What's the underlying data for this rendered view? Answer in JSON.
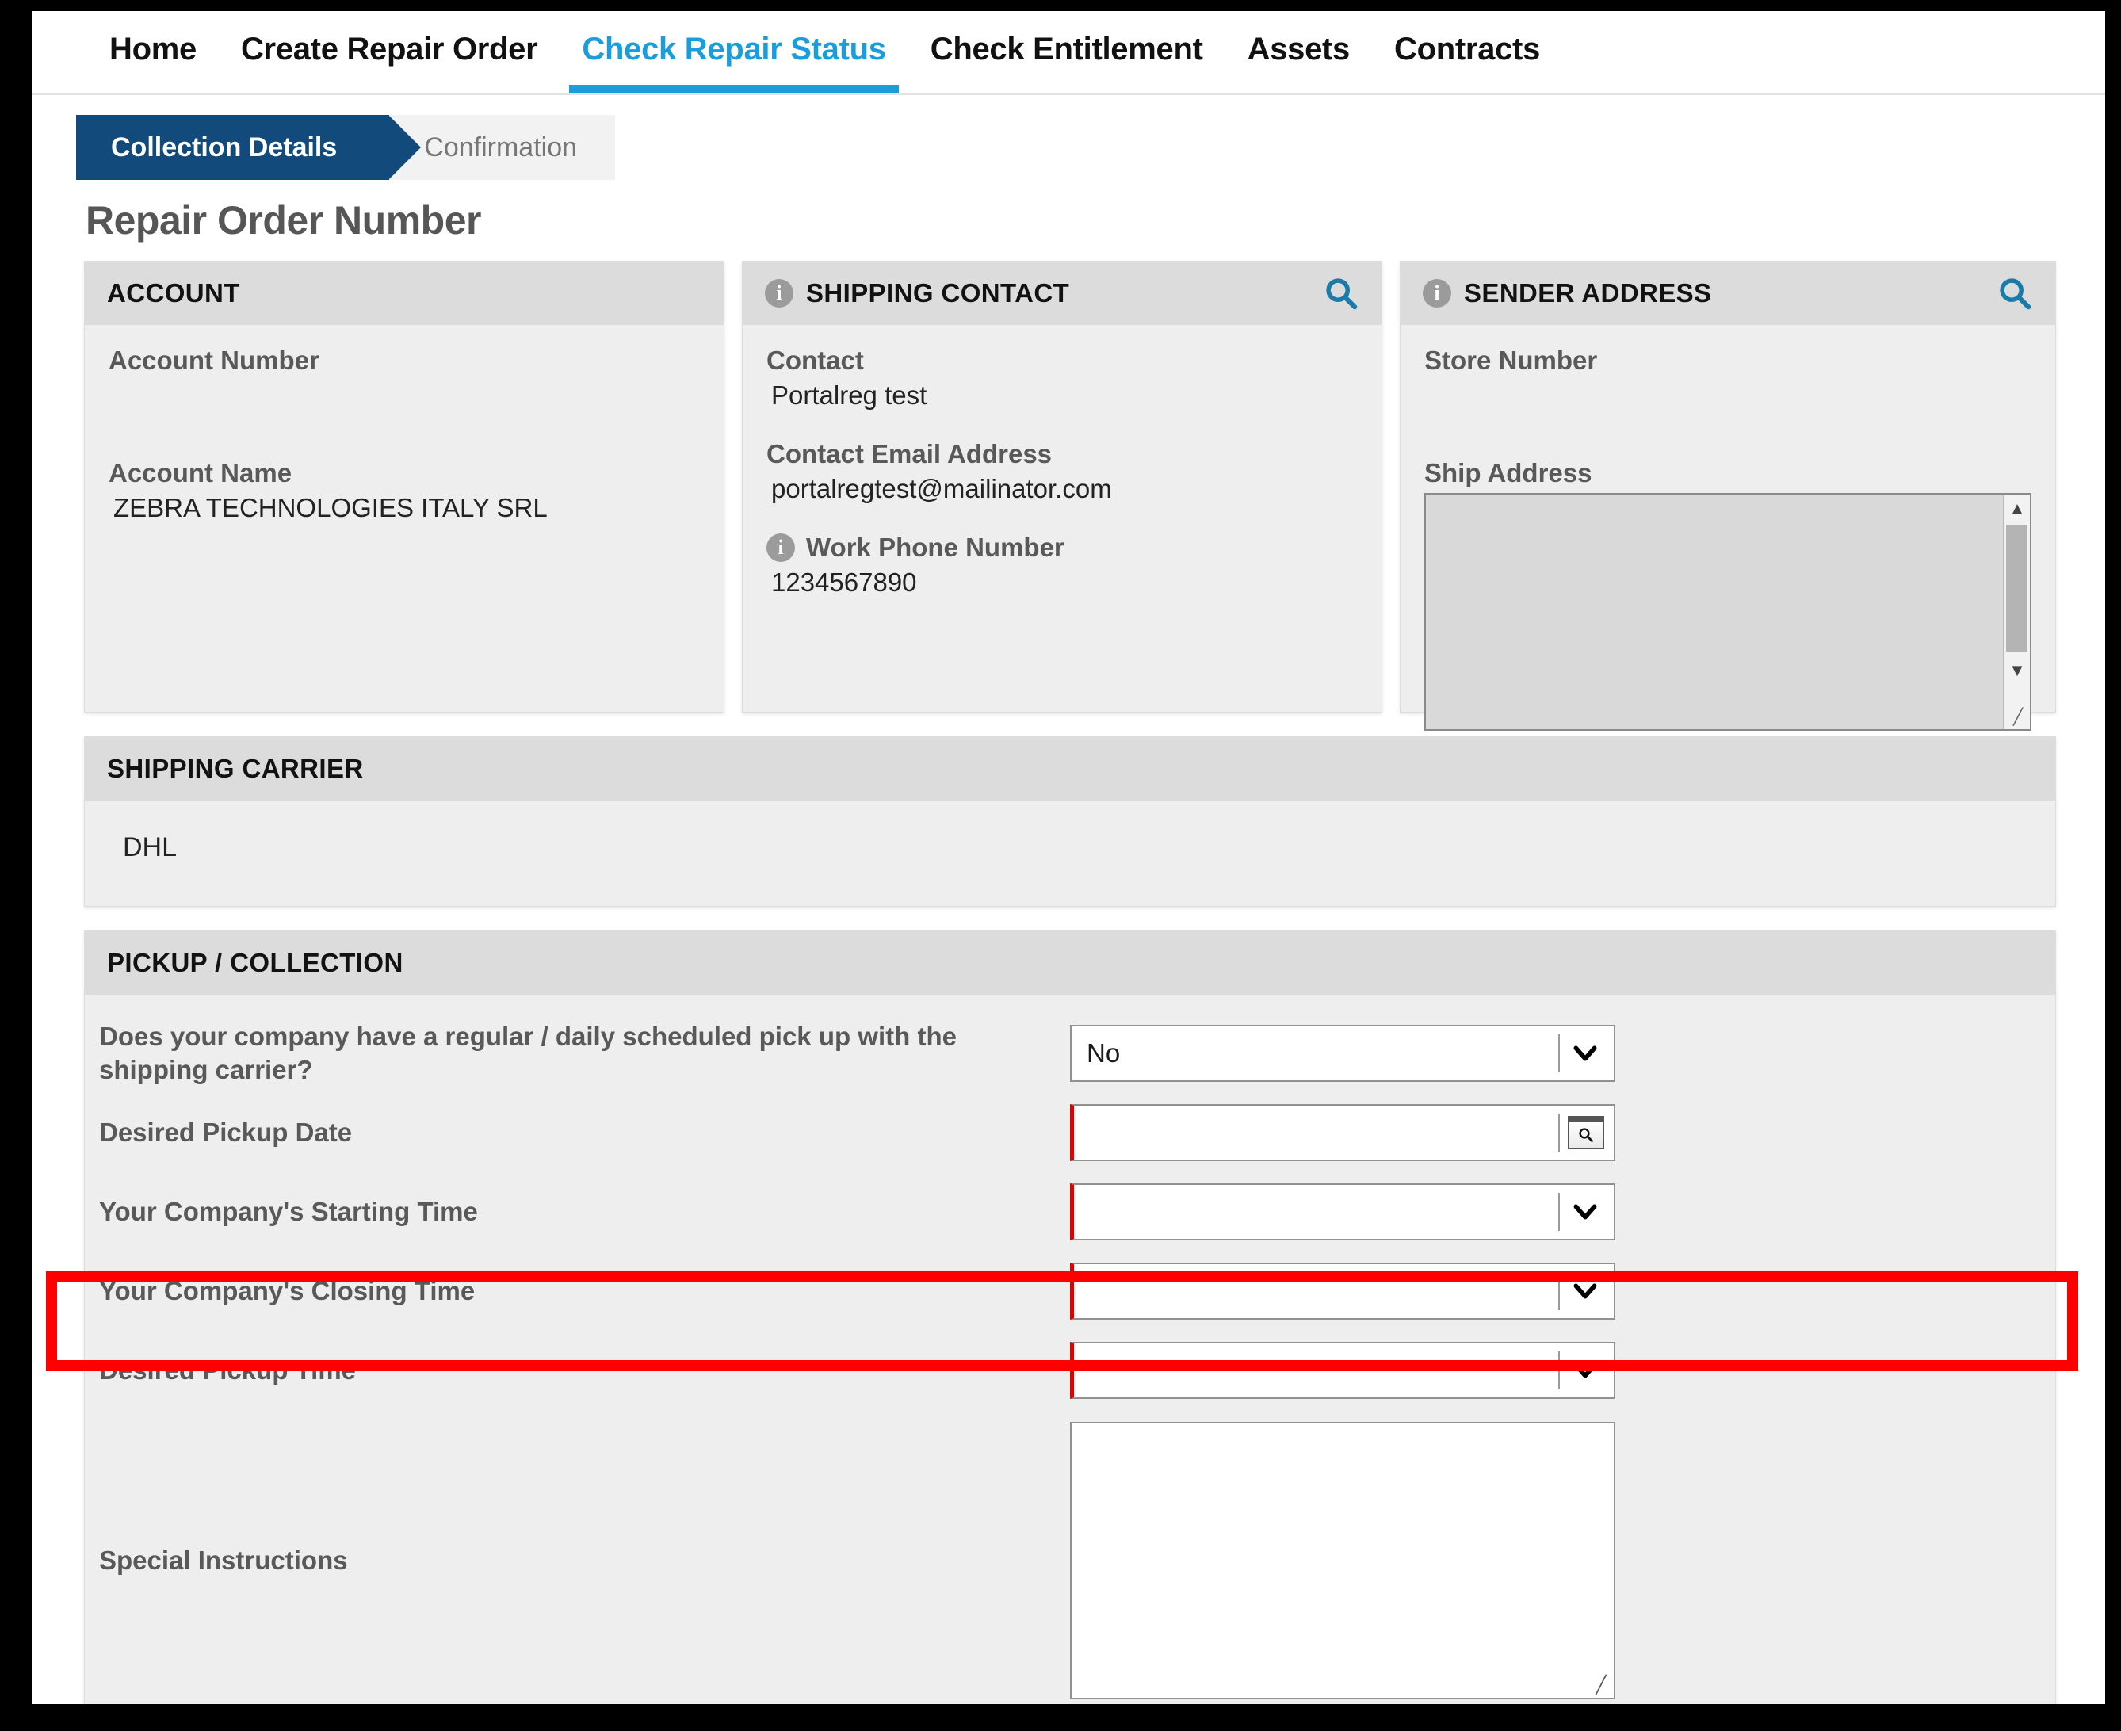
{
  "nav": {
    "items": [
      {
        "label": "Home",
        "active": false
      },
      {
        "label": "Create Repair Order",
        "active": false
      },
      {
        "label": "Check Repair Status",
        "active": true
      },
      {
        "label": "Check Entitlement",
        "active": false
      },
      {
        "label": "Assets",
        "active": false
      },
      {
        "label": "Contracts",
        "active": false
      }
    ],
    "active_color": "#1b9ddb"
  },
  "wizard": {
    "steps": [
      {
        "label": "Collection Details",
        "state": "active"
      },
      {
        "label": "Confirmation",
        "state": "inactive"
      }
    ],
    "active_color": "#134a7c",
    "inactive_color": "#f2f2f2"
  },
  "page_title": "Repair Order Number",
  "account_card": {
    "header": "ACCOUNT",
    "fields": [
      {
        "label": "Account Number",
        "value": ""
      },
      {
        "label": "Account Name",
        "value": "ZEBRA TECHNOLOGIES ITALY SRL"
      }
    ]
  },
  "shipping_contact_card": {
    "header": "SHIPPING CONTACT",
    "has_info_icon": true,
    "search_icon": "search-icon",
    "fields": [
      {
        "label": "Contact",
        "value": "Portalreg test",
        "info": false
      },
      {
        "label": "Contact Email Address",
        "value": "portalregtest@mailinator.com",
        "info": false
      },
      {
        "label": "Work Phone Number",
        "value": "1234567890",
        "info": true
      }
    ]
  },
  "sender_address_card": {
    "header": "SENDER ADDRESS",
    "has_info_icon": true,
    "search_icon": "search-icon",
    "store_number_label": "Store Number",
    "store_number_value": "",
    "ship_address_label": "Ship Address",
    "ship_address_value": ""
  },
  "shipping_carrier": {
    "header": "SHIPPING CARRIER",
    "value": "DHL"
  },
  "pickup": {
    "header": "PICKUP / COLLECTION",
    "rows": [
      {
        "label": "Does your company have a regular / daily scheduled pick up with the shipping carrier?",
        "control": "select",
        "value": "No",
        "required": false
      },
      {
        "label": "Desired Pickup Date",
        "control": "date",
        "value": "",
        "required": true,
        "lookup_icon": "calendar-lookup-icon"
      },
      {
        "label": "Your Company's Starting Time",
        "control": "select",
        "value": "",
        "required": true
      },
      {
        "label": "Your Company's Closing Time",
        "control": "select",
        "value": "",
        "required": true,
        "highlighted": true
      },
      {
        "label": "Desired Pickup Time",
        "control": "select",
        "value": "",
        "required": true
      },
      {
        "label": "Special Instructions",
        "control": "textarea",
        "value": "",
        "required": false
      }
    ]
  },
  "annotation": {
    "type": "highlight-box",
    "color": "#ff0000",
    "target": "Your Company's Closing Time"
  }
}
